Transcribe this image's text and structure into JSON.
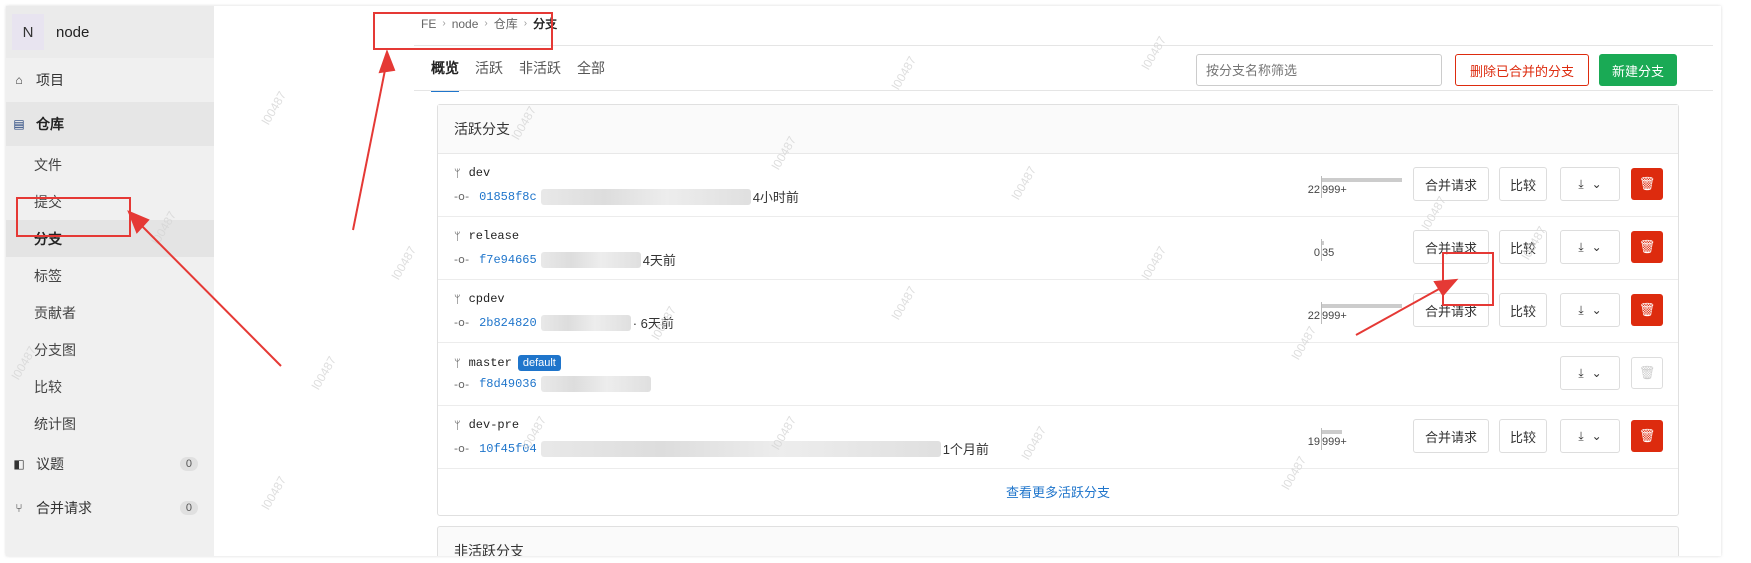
{
  "sidebar": {
    "project_initial": "N",
    "project_name": "node",
    "items": [
      {
        "label": "项目",
        "icon": "home-icon"
      },
      {
        "label": "仓库",
        "icon": "document-icon"
      }
    ],
    "repo_sub": [
      "文件",
      "提交",
      "分支",
      "标签",
      "贡献者",
      "分支图",
      "比较",
      "统计图"
    ],
    "issues": {
      "label": "议题",
      "count": "0"
    },
    "merge_requests": {
      "label": "合并请求",
      "count": "0"
    }
  },
  "breadcrumb": [
    "FE",
    "node",
    "仓库",
    "分支"
  ],
  "tabs": [
    "概览",
    "活跃",
    "非活跃",
    "全部"
  ],
  "filter_placeholder": "按分支名称筛选",
  "buttons": {
    "delete_merged": "删除已合并的分支",
    "new_branch": "新建分支",
    "merge_request": "合并请求",
    "compare": "比较"
  },
  "active_section_title": "活跃分支",
  "branches": [
    {
      "name": "dev",
      "sha": "01858f8c",
      "time": "4小时前",
      "behind": "22",
      "ahead": "999+",
      "default": false
    },
    {
      "name": "release",
      "sha": "f7e94665",
      "time": "4天前",
      "behind": "0",
      "ahead": "35",
      "default": false
    },
    {
      "name": "cpdev",
      "sha": "2b824820",
      "time": "· 6天前",
      "behind": "22",
      "ahead": "999+",
      "default": false
    },
    {
      "name": "master",
      "sha": "f8d49036",
      "time": "",
      "behind": "",
      "ahead": "",
      "default": true,
      "default_label": "default"
    },
    {
      "name": "dev-pre",
      "sha": "10f45f04",
      "time": "1个月前",
      "behind": "19",
      "ahead": "999+",
      "default": false
    }
  ],
  "more_active": "查看更多活跃分支",
  "inactive_section_title": "非活跃分支",
  "watermark": "l00487",
  "colors": {
    "danger": "#dd2b0e",
    "success": "#1aaa55",
    "link": "#1f75cb",
    "annotation": "#e53935"
  }
}
